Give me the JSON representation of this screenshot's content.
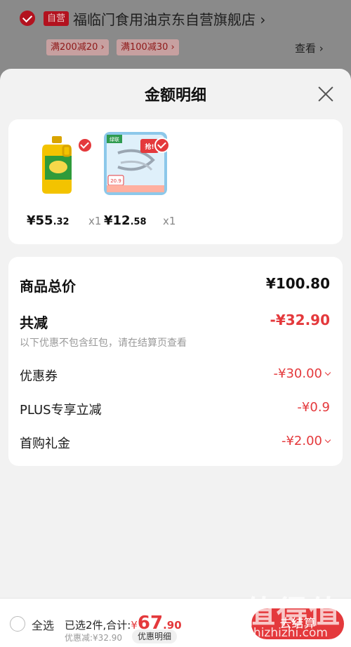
{
  "background": {
    "badge": "自营",
    "shop_name": "福临门食用油京东自营旗舰店",
    "shop_chevron": "›",
    "coupons": [
      "满200减20 ›",
      "满100减30 ›"
    ],
    "view_label": "查看 ›"
  },
  "sheet": {
    "title": "金额明细",
    "products": [
      {
        "price_int": "¥55",
        "price_dec": ".32",
        "qty": "x1",
        "image": "cooking-oil-bottle"
      },
      {
        "price_int": "¥12",
        "price_dec": ".58",
        "qty": "x1",
        "image": "charging-cable",
        "image_text": "绿联",
        "badge_text": "抢!",
        "price_tag": "20.9"
      }
    ],
    "rows": {
      "total_label": "商品总价",
      "total_value": "¥100.80",
      "reduce_label": "共减",
      "reduce_value": "-¥32.90",
      "reduce_note": "以下优惠不包含红包，请在结算页查看",
      "coupon_label": "优惠券",
      "coupon_value": "-¥30.00",
      "plus_label": "PLUS专享立减",
      "plus_value": "-¥0.9",
      "gift_label": "首购礼金",
      "gift_value": "-¥2.00"
    }
  },
  "bottom_bar": {
    "select_all": "全选",
    "selected_summary": "已选2件,合计:",
    "sum_currency": "¥",
    "sum_int": "67",
    "sum_dec": ".90",
    "discount_text": "优惠减:¥32.90",
    "detail_button": "优惠明细",
    "checkout_label": "去结算"
  },
  "watermark": {
    "text": "值得值",
    "url": "zhizhizhi.com"
  },
  "colors": {
    "accent": "#e4393c",
    "brand_dark": "#b3121f",
    "overlay": "#7e7e7e"
  }
}
